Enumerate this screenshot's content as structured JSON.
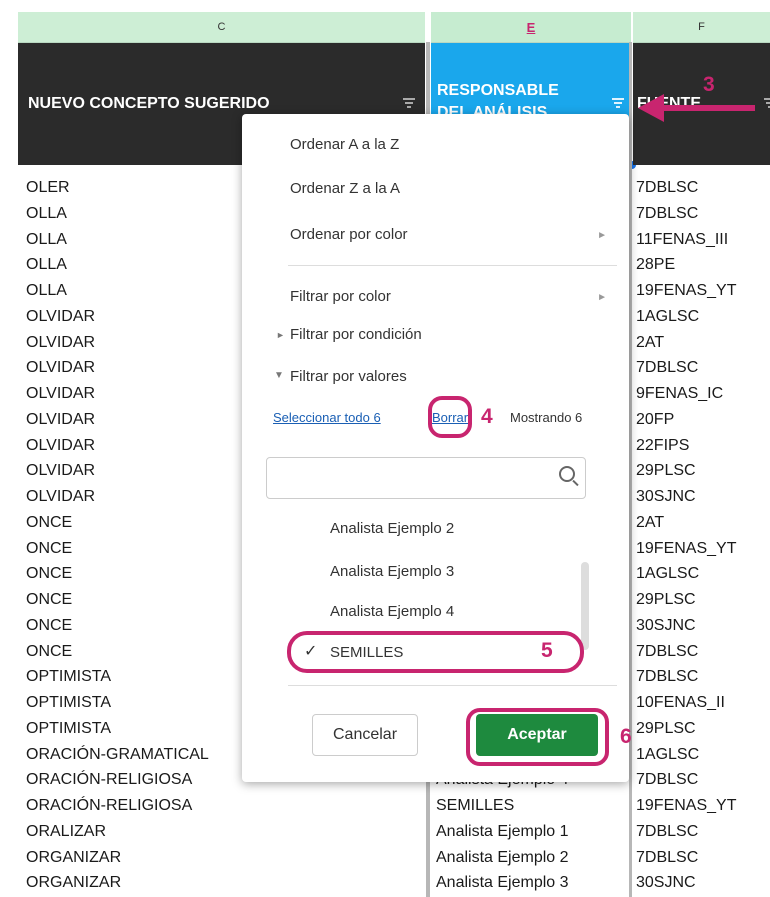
{
  "columns": {
    "c": "C",
    "e": "E",
    "f": "F"
  },
  "headers": {
    "c": "NUEVO CONCEPTO SUGERIDO",
    "e_line1": "RESPONSABLE",
    "e_line2": "DEL ANÁLISIS",
    "f": "FUENTE"
  },
  "col_c": [
    "OLER",
    "OLLA",
    "OLLA",
    "OLLA",
    "OLLA",
    "OLVIDAR",
    "OLVIDAR",
    "OLVIDAR",
    "OLVIDAR",
    "OLVIDAR",
    "OLVIDAR",
    "OLVIDAR",
    "OLVIDAR",
    "ONCE",
    "ONCE",
    "ONCE",
    "ONCE",
    "ONCE",
    "ONCE",
    "OPTIMISTA",
    "OPTIMISTA",
    "OPTIMISTA",
    "ORACIÓN-GRAMATICAL",
    "ORACIÓN-RELIGIOSA",
    "ORACIÓN-RELIGIOSA",
    "ORALIZAR",
    "ORGANIZAR",
    "ORGANIZAR"
  ],
  "col_f": [
    "7DBLSC",
    "7DBLSC",
    "11FENAS_III",
    "28PE",
    "19FENAS_YT",
    "1AGLSC",
    "2AT",
    "7DBLSC",
    "9FENAS_IC",
    "20FP",
    "22FIPS",
    "29PLSC",
    "30SJNC",
    "2AT",
    "19FENAS_YT",
    "1AGLSC",
    "29PLSC",
    "30SJNC",
    "7DBLSC",
    "7DBLSC",
    "10FENAS_II",
    "29PLSC",
    "1AGLSC",
    "7DBLSC",
    "19FENAS_YT",
    "7DBLSC",
    "7DBLSC",
    "30SJNC"
  ],
  "col_e_visible": [
    {
      "row": 23,
      "text": "Analista Ejemplo 4"
    },
    {
      "row": 24,
      "text": "SEMILLES"
    },
    {
      "row": 25,
      "text": "Analista Ejemplo 1"
    },
    {
      "row": 26,
      "text": "Analista Ejemplo 2"
    },
    {
      "row": 27,
      "text": "Analista Ejemplo 3"
    }
  ],
  "menu": {
    "sort_az": "Ordenar A a la Z",
    "sort_za": "Ordenar Z a la A",
    "sort_color": "Ordenar por color",
    "filter_color": "Filtrar por color",
    "filter_condition": "Filtrar por condición",
    "filter_values": "Filtrar por valores",
    "select_all": "Seleccionar todo 6",
    "clear": "Borrar",
    "showing": "Mostrando 6",
    "options": [
      "Analista Ejemplo 2",
      "Analista Ejemplo 3",
      "Analista Ejemplo 4"
    ],
    "selected_option": "SEMILLES",
    "cancel": "Cancelar",
    "accept": "Aceptar"
  },
  "annotations": {
    "n3": "3",
    "n4": "4",
    "n5": "5",
    "n6": "6"
  },
  "colors": {
    "accent": "#c8256f",
    "ok": "#1e8a3e",
    "header_blue": "#1aa7ec"
  }
}
